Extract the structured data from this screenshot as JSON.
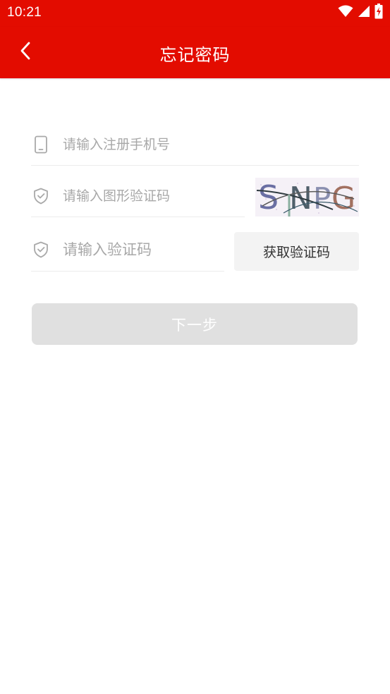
{
  "status_bar": {
    "time": "10:21",
    "icons": [
      "wifi-icon",
      "cellular-signal-icon",
      "battery-charging-icon"
    ]
  },
  "header": {
    "title": "忘记密码",
    "back_icon": "chevron-left-icon",
    "background_color": "#e30c00"
  },
  "form": {
    "phone": {
      "placeholder": "请输入注册手机号",
      "value": "",
      "icon": "phone-icon"
    },
    "captcha": {
      "placeholder": "请输入图形验证码",
      "value": "",
      "icon": "shield-check-icon",
      "image_text": "SNPG"
    },
    "sms_code": {
      "placeholder": "请输入验证码",
      "value": "",
      "icon": "shield-check-icon"
    },
    "get_code_label": "获取验证码",
    "next_label": "下一步"
  }
}
